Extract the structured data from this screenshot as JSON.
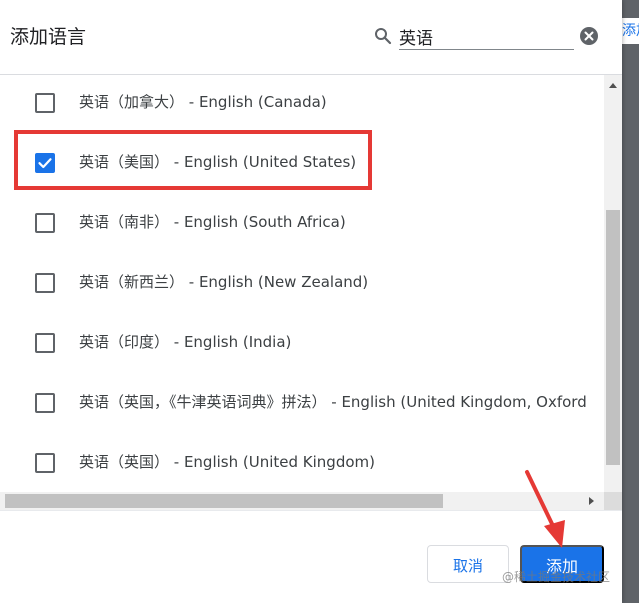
{
  "background_page": {
    "partial_label": "添加"
  },
  "dialog": {
    "title": "添加语言",
    "search": {
      "value": "英语",
      "placeholder": "",
      "icon": "search-icon",
      "clear_icon": "clear-icon"
    },
    "languages": [
      {
        "label": "英语（加拿大） - English (Canada)",
        "checked": false
      },
      {
        "label": "英语（美国） - English (United States)",
        "checked": true
      },
      {
        "label": "英语（南非） - English (South Africa)",
        "checked": false
      },
      {
        "label": "英语（新西兰） - English (New Zealand)",
        "checked": false
      },
      {
        "label": "英语（印度） - English (India)",
        "checked": false
      },
      {
        "label": "英语（英国，《牛津英语词典》拼法） - English (United Kingdom, Oxford",
        "checked": false
      },
      {
        "label": "英语（英国） - English (United Kingdom)",
        "checked": false
      }
    ],
    "buttons": {
      "cancel_label": "取消",
      "add_label": "添加"
    }
  },
  "annotations": {
    "highlight_color": "#e53935",
    "arrow_color": "#e53935"
  },
  "watermark": "@稀土掘金技术社区",
  "colors": {
    "accent": "#1a73e8",
    "text": "#3c4043",
    "scrollbar": "#c1c1c1"
  }
}
